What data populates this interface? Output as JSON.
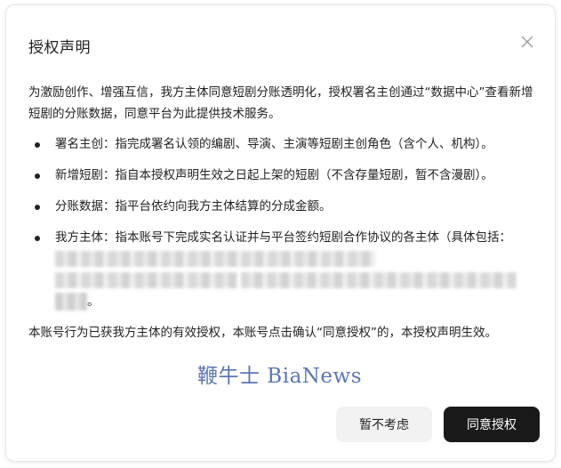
{
  "dialog": {
    "title": "授权声明",
    "close_icon": "close-icon",
    "intro": "为激励创作、增强互信，我方主体同意短剧分账透明化，授权署名主创通过“数据中心”查看新增短剧的分账数据，同意平台为此提供技术服务。",
    "items": [
      {
        "text": "署名主创：指完成署名认领的编剧、导演、主演等短剧主创角色（含个人、机构）。"
      },
      {
        "text": "新增短剧：指自本授权声明生效之日起上架的短剧（不含存量短剧，暂不含漫剧）。"
      },
      {
        "text": "分账数据：指平台依约向我方主体结算的分成金额。"
      },
      {
        "text": "我方主体：指本账号下完成实名认证并与平台签约短剧合作协议的各主体（具体包括：",
        "suffix": "。"
      }
    ],
    "footer_text": "本账号行为已获我方主体的有效授权，本账号点击确认“同意授权”的，本授权声明生效。",
    "buttons": {
      "decline_label": "暂不考虑",
      "accept_label": "同意授权"
    }
  },
  "watermark": "鞭牛士 BiaNews",
  "colors": {
    "primary_button": "#1a1a1a",
    "secondary_button": "#f2f2f2",
    "watermark": "#3f5fa8"
  }
}
